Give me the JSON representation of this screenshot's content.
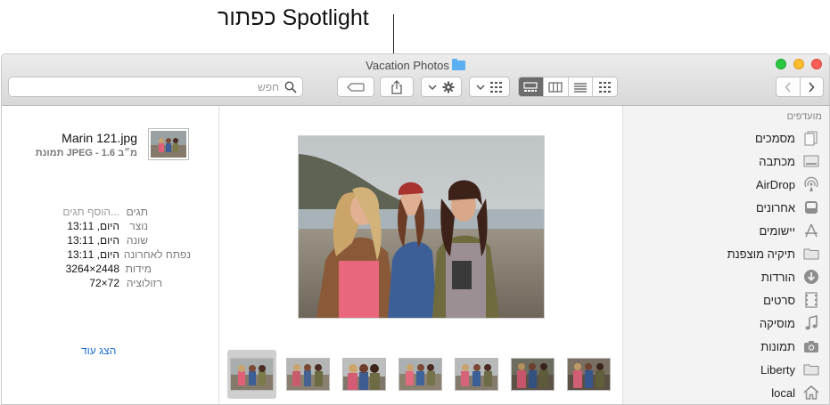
{
  "callout": {
    "text": "כפתור Spotlight"
  },
  "window": {
    "title": "Vacation Photos",
    "traffic_colors": {
      "close": "#fc5f57",
      "minimize": "#fdbb2e",
      "zoom": "#28c840"
    }
  },
  "search": {
    "placeholder": "חפש"
  },
  "file_info": {
    "name": "Marin 121.jpg",
    "description": "תמונת JPEG - 1.6 מ״ב",
    "metadata": [
      {
        "key": "תגים",
        "value": "הוסף תגים..."
      },
      {
        "key": "נוצר",
        "value": "היום, 13:11"
      },
      {
        "key": "שונה",
        "value": "היום, 13:11"
      },
      {
        "key": "נפתח לאחרונה",
        "value": "היום, 13:11"
      },
      {
        "key": "מידות",
        "value": "3264×2448"
      },
      {
        "key": "רזולוציה",
        "value": "72×72"
      }
    ],
    "show_more": "הצג עוד"
  },
  "sidebar": {
    "header": "מועדפים",
    "items": [
      {
        "label": "מסמכים",
        "icon": "documents-icon"
      },
      {
        "label": "מכתבה",
        "icon": "desktop-icon"
      },
      {
        "label": "AirDrop",
        "icon": "airdrop-icon"
      },
      {
        "label": "אחרונים",
        "icon": "recents-icon"
      },
      {
        "label": "יישומים",
        "icon": "applications-icon"
      },
      {
        "label": "תיקיה מוצפנת",
        "icon": "folder-icon"
      },
      {
        "label": "הורדות",
        "icon": "downloads-icon"
      },
      {
        "label": "סרטים",
        "icon": "movies-icon"
      },
      {
        "label": "מוסיקה",
        "icon": "music-icon"
      },
      {
        "label": "תמונות",
        "icon": "pictures-icon"
      },
      {
        "label": "Liberty",
        "icon": "folder-icon"
      },
      {
        "label": "local",
        "icon": "home-icon"
      }
    ]
  }
}
